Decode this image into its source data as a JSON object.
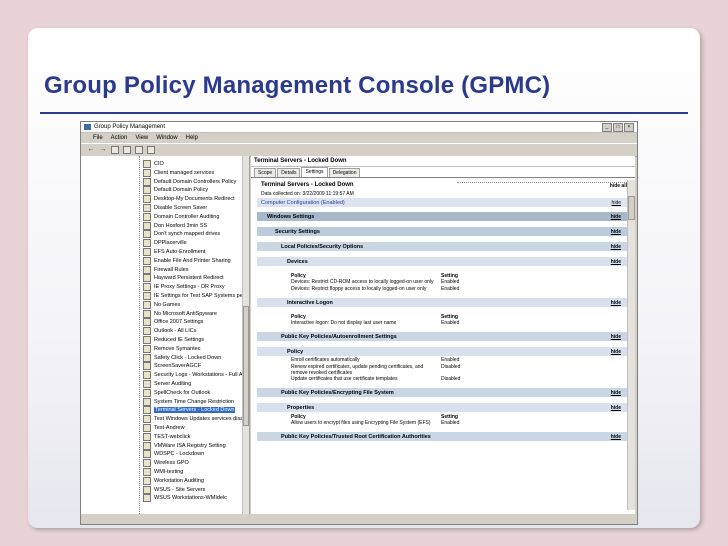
{
  "slide_title": "Group Policy Management Console (GPMC)",
  "window": {
    "title": "Group Policy Management",
    "menu": [
      "File",
      "Action",
      "View",
      "Window",
      "Help"
    ],
    "controls": {
      "min": "_",
      "max": "□",
      "close": "×"
    }
  },
  "toolbar": {
    "back_icon": "back-arrow",
    "forward_icon": "forward-arrow"
  },
  "tree": {
    "items": [
      "CIO",
      "Client managed services",
      "Default Domain Controllers Policy",
      "Default Domain Policy",
      "Desktop-My Documents Redirect",
      "Disable Screen Saver",
      "Domain Controller Auditing",
      "Don Hosford 3min SS",
      "Don't synch mapped drives",
      "DPPlacerville",
      "EFS Auto-Enrollment",
      "Enable File And Printer Sharing",
      "Firewall Rules",
      "Hayward Persistent Redirect",
      "IE Proxy Settings - DR Proxy",
      "IE Settings for Test SAP Systems per",
      "No Games",
      "No Microsoft AntiSpyware",
      "Office 2007 Settings",
      "Outlook - All LICs",
      "Reduced IE Settings",
      "Remove Symantec",
      "Safety Click - Locked Down",
      "ScreenSaverAGCF",
      "Security Logs - Workstations - Full Ac",
      "Server Auditing",
      "SpellCheck for Outlook",
      "System Time Change Restriction",
      "Terminal Servers - Locked Down",
      "Test Windows Updates services disa",
      "Test-Andrew",
      "TEST-webclick",
      "VMWare ISA Registry Setting",
      "WDSPC - Lockdown",
      "Wireless GPO",
      "WMI-testing",
      "Workstation Auditing",
      "WSUS - Site Servers",
      "WSUS Workstations-WMIdelc"
    ],
    "selected_index": 28
  },
  "right": {
    "title": "Terminal Servers - Locked Down",
    "tabs": [
      "Scope",
      "Details",
      "Settings",
      "Delegation"
    ],
    "active_tab": 2,
    "report": {
      "heading": "Terminal Servers - Locked Down",
      "hide_all": "hide all",
      "collected": "Data collected on: 3/22/2009 11:19:57 AM",
      "computer_config": "Computer Configuration (Enabled)",
      "hide": "hide",
      "sections": {
        "windows_settings": "Windows Settings",
        "security_settings": "Security Settings",
        "local_policies": "Local Policies/Security Options",
        "devices": "Devices",
        "interactive_logon": "Interactive Logon",
        "pk_autoenroll": "Public Key Policies/Autoenrollment Settings",
        "policy_head": "Policy",
        "pk_efs": "Public Key Policies/Encrypting File System",
        "properties": "Properties",
        "pk_trusted": "Public Key Policies/Trusted Root Certification Authorities"
      },
      "col_policy": "Policy",
      "col_setting": "Setting",
      "devices_rows": [
        {
          "policy": "Devices: Restrict CD-ROM access to locally logged-on user only",
          "setting": "Enabled"
        },
        {
          "policy": "Devices: Restrict floppy access to locally logged-on user only",
          "setting": "Enabled"
        }
      ],
      "logon_rows": [
        {
          "policy": "Interactive logon: Do not display last user name",
          "setting": "Enabled"
        }
      ],
      "autoenroll_rows": [
        {
          "policy": "Enroll certificates automatically",
          "setting": "Enabled"
        },
        {
          "policy": "Renew expired certificates, update pending certificates, and remove revoked certificates",
          "setting": "Disabled"
        },
        {
          "policy": "Update certificates that use certificate templates",
          "setting": "Disabled"
        }
      ],
      "efs_rows": [
        {
          "policy": "Allow users to encrypt files using Encrypting File System (EFS)",
          "setting": "Enabled"
        }
      ]
    }
  }
}
